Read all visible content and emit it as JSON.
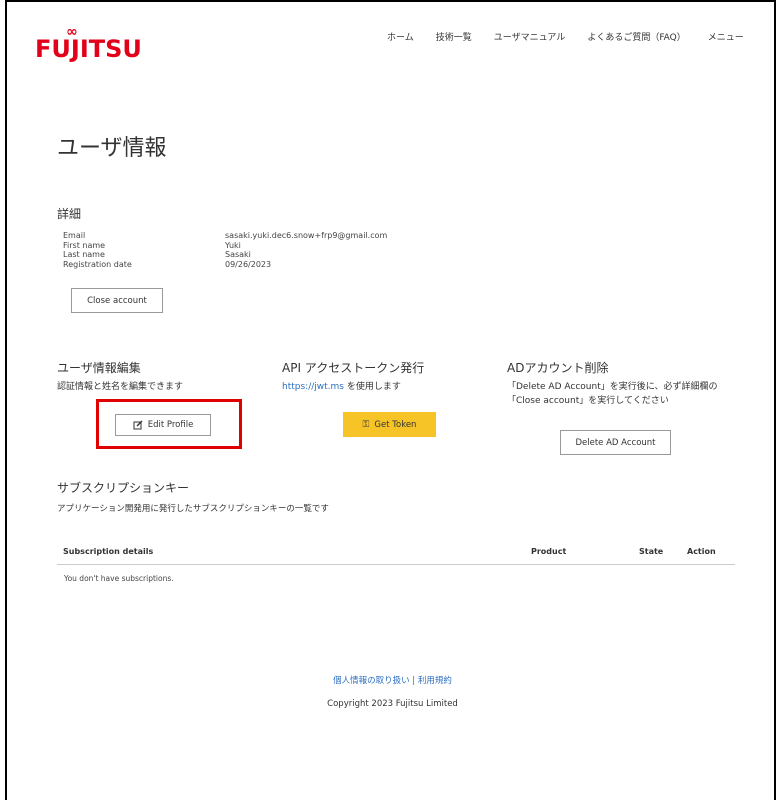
{
  "header": {
    "logo_text": "FUJITSU",
    "nav": [
      "ホーム",
      "技術一覧",
      "ユーザマニュアル",
      "よくあるご質問（FAQ）",
      "メニュー"
    ]
  },
  "page_title": "ユーザ情報",
  "details": {
    "heading": "詳細",
    "labels": [
      "Email",
      "First name",
      "Last name",
      "Registration date"
    ],
    "values": [
      "sasaki.yuki.dec6.snow+frp9@gmail.com",
      "Yuki",
      "Sasaki",
      "09/26/2023"
    ],
    "close_button": "Close account"
  },
  "profile": {
    "heading": "ユーザ情報編集",
    "text": "認証情報と姓名を編集できます",
    "button": "Edit Profile"
  },
  "api": {
    "heading": "API アクセストークン発行",
    "link": "https://jwt.ms",
    "text_suffix": " を使用します",
    "button": "Get Token"
  },
  "ad": {
    "heading": "ADアカウント削除",
    "text_line1": "「Delete AD Account」を実行後に、必ず詳細欄の",
    "text_line2": "「Close account」を実行してください",
    "button": "Delete AD Account"
  },
  "subscriptions": {
    "heading": "サブスクリプションキー",
    "text": "アプリケーション開発用に発行したサブスクリプションキーの一覧です",
    "columns": [
      "Subscription details",
      "Product",
      "State",
      "Action"
    ],
    "empty_text": "You don't have subscriptions."
  },
  "footer": {
    "privacy": "個人情報の取り扱い",
    "separator": " | ",
    "terms": "利用規約",
    "copyright": "Copyright 2023 Fujitsu Limited"
  },
  "colors": {
    "brand": "#e2001a",
    "accent": "#f7c428",
    "link": "#2b6fc2",
    "highlight": "#e00000"
  }
}
